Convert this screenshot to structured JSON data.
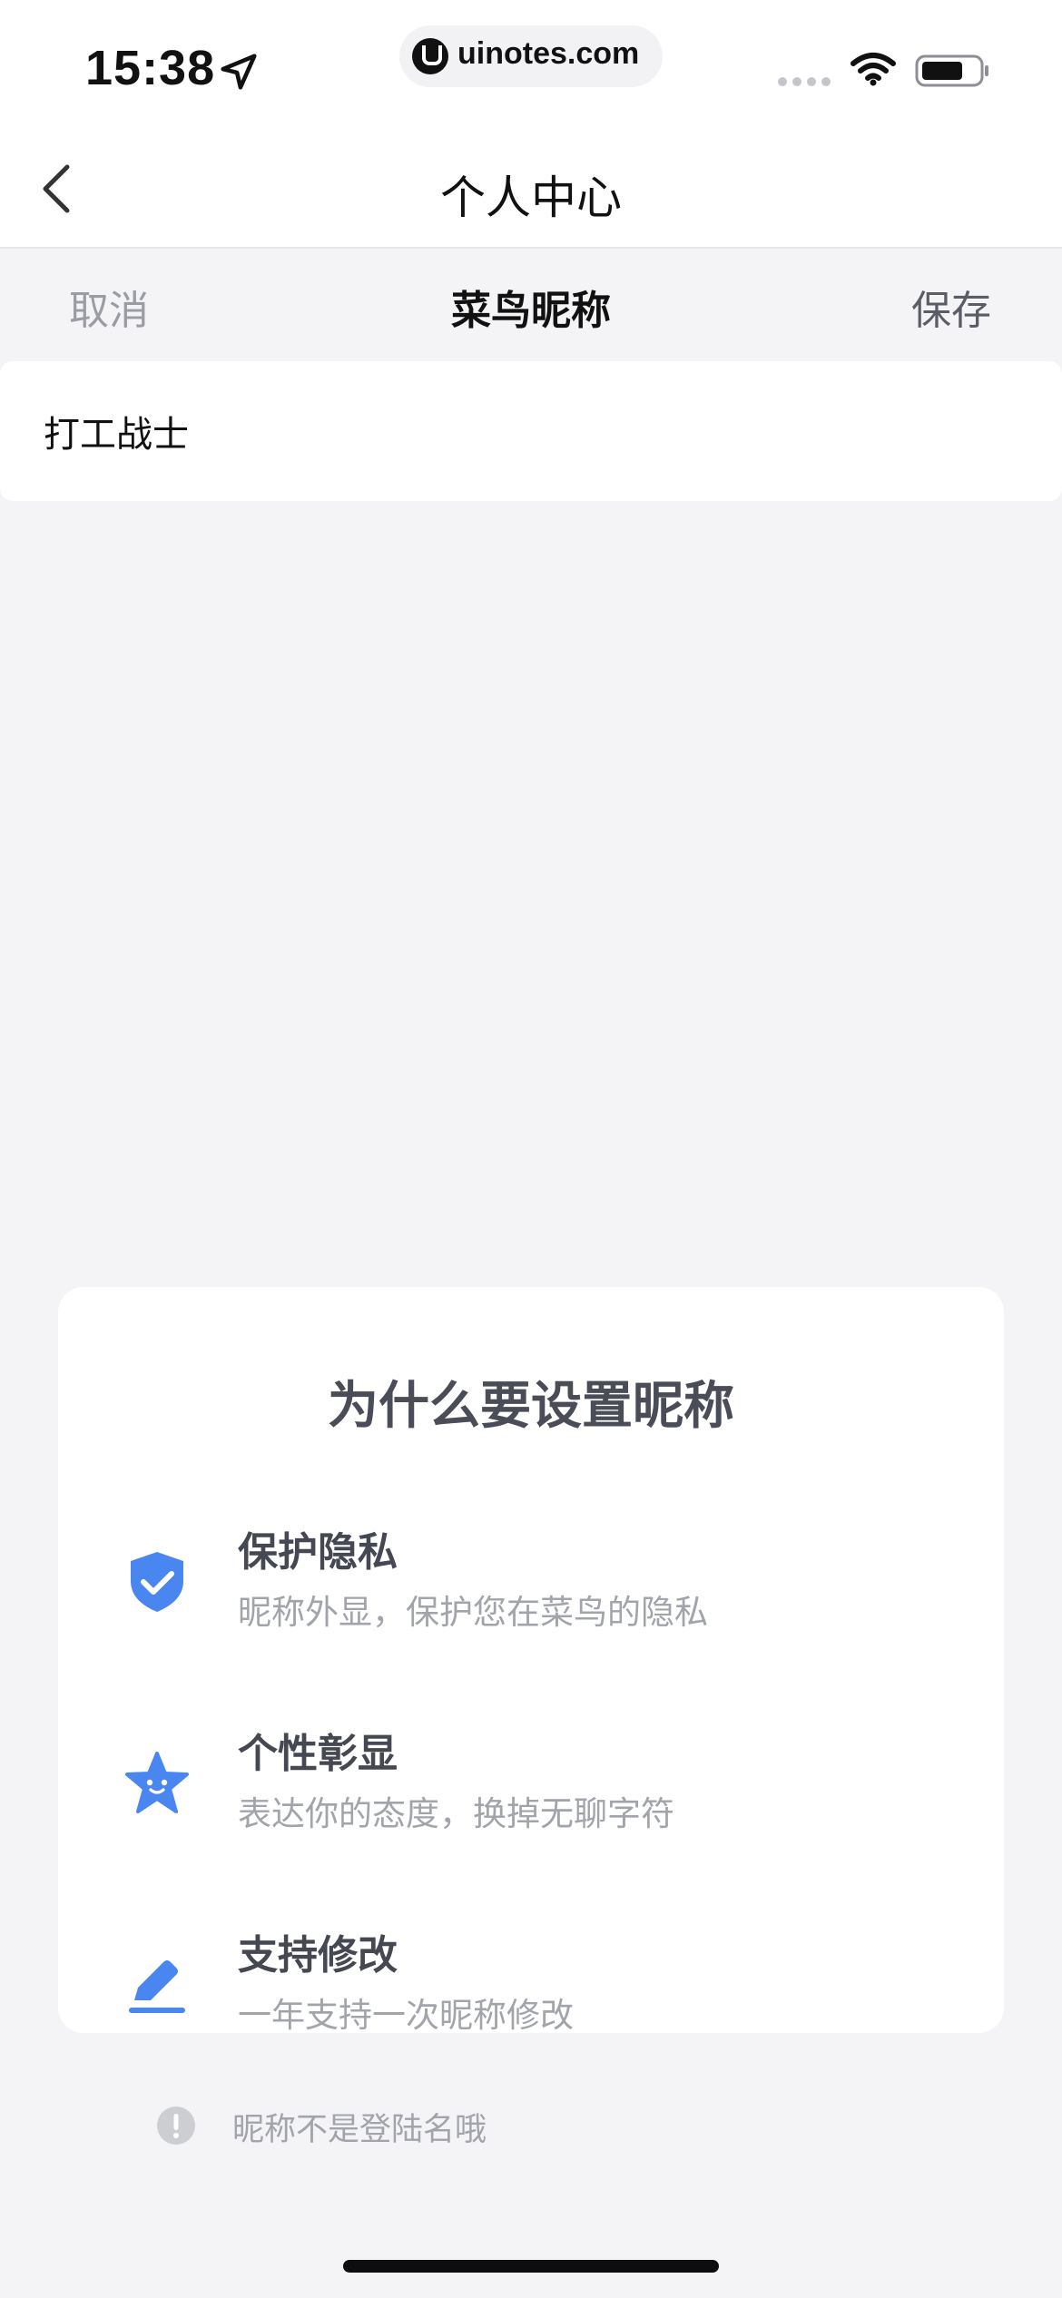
{
  "status_bar": {
    "time": "15:38",
    "url": "uinotes.com",
    "location_icon": "location-arrow-icon",
    "wifi_icon": "wifi-icon",
    "battery_icon": "battery-icon"
  },
  "nav": {
    "title": "个人中心",
    "back_icon": "chevron-left-icon"
  },
  "edit_bar": {
    "cancel_label": "取消",
    "title": "菜鸟昵称",
    "save_label": "保存"
  },
  "nickname": {
    "value": "打工战士"
  },
  "info": {
    "title": "为什么要设置昵称",
    "items": [
      {
        "icon": "shield-check-icon",
        "title": "保护隐私",
        "desc": "昵称外显，保护您在菜鸟的隐私"
      },
      {
        "icon": "smiling-star-icon",
        "title": "个性彰显",
        "desc": "表达你的态度，换掉无聊字符"
      },
      {
        "icon": "pencil-icon",
        "title": "支持修改",
        "desc": "一年支持一次昵称修改"
      }
    ],
    "note_icon": "exclamation-circle-icon",
    "note": "昵称不是登陆名哦"
  },
  "colors": {
    "accent": "#4a86f0",
    "background": "#f4f4f6",
    "card": "#ffffff",
    "muted_text": "#a2a4ab"
  }
}
